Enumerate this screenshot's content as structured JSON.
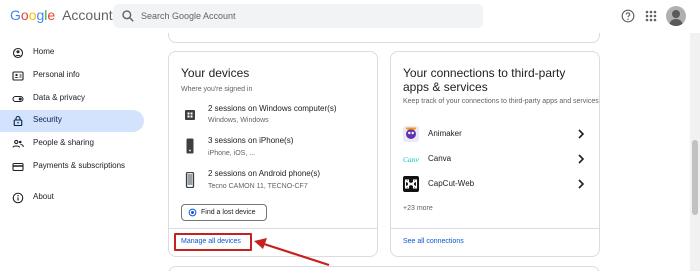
{
  "header": {
    "logo_google": [
      "G",
      "o",
      "o",
      "g",
      "l",
      "e"
    ],
    "logo_account": "Account",
    "search_placeholder": "Search Google Account"
  },
  "sidebar": {
    "items": [
      {
        "label": "Home",
        "icon": "home-icon",
        "active": false
      },
      {
        "label": "Personal info",
        "icon": "id-card-icon",
        "active": false
      },
      {
        "label": "Data & privacy",
        "icon": "toggle-icon",
        "active": false
      },
      {
        "label": "Security",
        "icon": "lock-icon",
        "active": true
      },
      {
        "label": "People & sharing",
        "icon": "people-icon",
        "active": false
      },
      {
        "label": "Payments & subscriptions",
        "icon": "credit-card-icon",
        "active": false
      },
      {
        "label": "About",
        "icon": "info-icon",
        "active": false
      }
    ]
  },
  "devices_card": {
    "title": "Your devices",
    "subtitle": "Where you're signed in",
    "devices": [
      {
        "title": "2 sessions on Windows computer(s)",
        "sub": "Windows, Windows",
        "icon": "windows-computer-icon"
      },
      {
        "title": "3 sessions on iPhone(s)",
        "sub": "iPhone, iOS, ...",
        "icon": "iphone-icon"
      },
      {
        "title": "2 sessions on Android phone(s)",
        "sub": "Tecno CAMON 11, TECNO-CF7",
        "icon": "android-phone-icon"
      }
    ],
    "find_button": "Find a lost device",
    "manage_link": "Manage all devices"
  },
  "connections_card": {
    "title_line1": "Your connections to third-party",
    "title_line2": "apps & services",
    "subtitle": "Keep track of your connections to third-party apps and services",
    "apps": [
      {
        "label": "Animaker",
        "icon": "animaker-icon"
      },
      {
        "label": "Canva",
        "icon": "canva-icon"
      },
      {
        "label": "CapCut-Web",
        "icon": "capcut-icon"
      }
    ],
    "more": "+23 more",
    "see_all": "See all connections",
    "canva_logo_text": "Canva"
  },
  "colors": {
    "accent": "#0b57d0",
    "active_nav": "#d3e3fd",
    "annotation_red": "#c5221f"
  }
}
